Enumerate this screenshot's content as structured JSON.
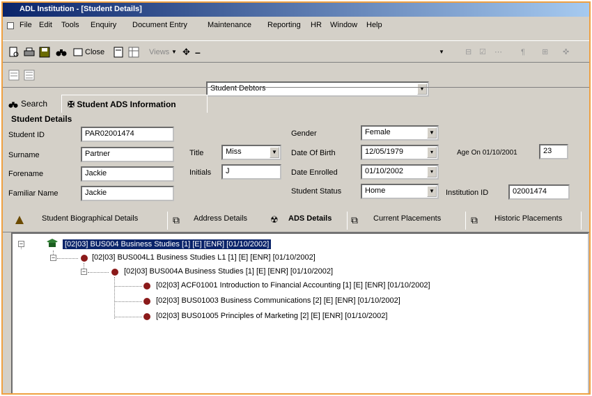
{
  "window": {
    "title": "ADL Institution - [Student Details]"
  },
  "menu": [
    "File",
    "Edit",
    "Tools",
    "Enquiry",
    "Document Entry",
    "Maintenance",
    "Reporting",
    "HR",
    "Window",
    "Help"
  ],
  "toolbar": {
    "close_label": "Close",
    "views_label": "Views",
    "search_combo": "Student Debtors"
  },
  "tabs": {
    "search": "Search",
    "info": "Student ADS Information"
  },
  "student": {
    "section_title": "Student Details",
    "labels": {
      "student_id": "Student ID",
      "surname": "Surname",
      "forename": "Forename",
      "familiar": "Familiar Name",
      "title": "Title",
      "initials": "Initials",
      "gender": "Gender",
      "dob": "Date Of Birth",
      "enrolled": "Date Enrolled",
      "status": "Student Status",
      "age_on": "Age On 01/10/2001",
      "institution_id": "Institution ID"
    },
    "values": {
      "student_id": "PAR02001474",
      "surname": "Partner",
      "forename": "Jackie",
      "familiar": "Jackie",
      "title": "Miss",
      "initials": "J",
      "gender": "Female",
      "dob": "12/05/1979",
      "enrolled": "01/10/2002",
      "status": "Home",
      "age": "23",
      "institution_id": "02001474"
    }
  },
  "subtabs": [
    "Student Biographical Details",
    "Address Details",
    "ADS Details",
    "Current Placements",
    "Historic Placements"
  ],
  "tree": [
    "[02|03] BUS004 Business Studies [1] [E] [ENR] [01/10/2002]",
    "[02|03] BUS004L1 Business Studies L1 [1] [E] [ENR] [01/10/2002]",
    "[02|03] BUS004A Business Studies [1] [E] [ENR] [01/10/2002]",
    "[02|03] ACF01001 Introduction to Financial Accounting [1] [E] [ENR] [01/10/2002]",
    "[02|03] BUS01003 Business Communications [2] [E] [ENR] [01/10/2002]",
    "[02|03] BUS01005 Principles of Marketing [2] [E] [ENR] [01/10/2002]"
  ],
  "colors": {
    "title_bar": "#0a246a",
    "selection": "#0a246a",
    "bullet": "#8b1a1a",
    "frame_border": "#f0a040"
  }
}
